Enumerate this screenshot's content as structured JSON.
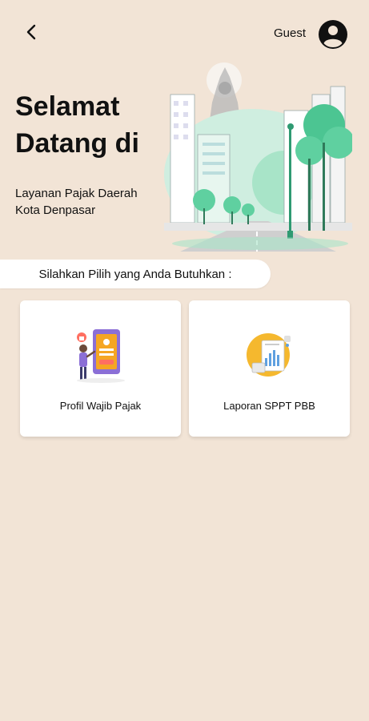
{
  "header": {
    "back_icon": "chevron-left-icon",
    "user_label": "Guest",
    "avatar_icon": "account-circle-icon"
  },
  "hero": {
    "greeting_line1": "Selamat",
    "greeting_line2": "Datang di",
    "subtitle_line1": "Layanan Pajak Daerah",
    "subtitle_line2": "Kota Denpasar",
    "illustration": "city-street-illustration"
  },
  "prompt": {
    "text": "Silahkan Pilih yang Anda Butuhkan :"
  },
  "menu": {
    "items": [
      {
        "label": "Profil Wajib Pajak",
        "icon": "taxpayer-profile-icon"
      },
      {
        "label": "Laporan SPPT PBB",
        "icon": "report-chart-icon"
      }
    ]
  },
  "colors": {
    "background": "#f2e4d6",
    "card": "#ffffff",
    "accent_green": "#5fd0a0",
    "accent_orange": "#f5a623",
    "accent_purple": "#8b6fd6"
  }
}
